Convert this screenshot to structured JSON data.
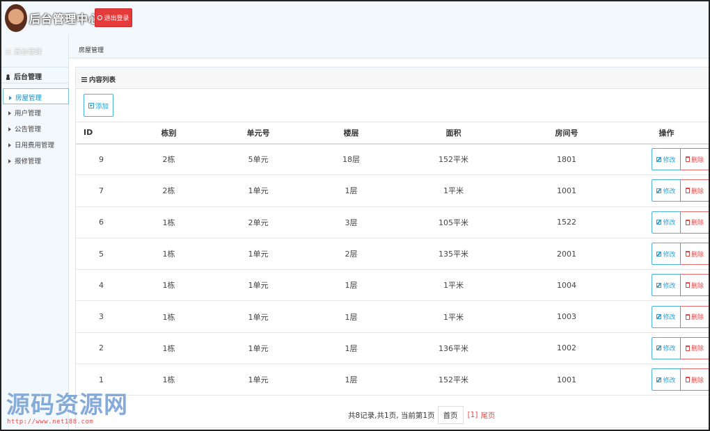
{
  "header": {
    "app_title": "后台管理中心",
    "logout_label": "退出登录"
  },
  "sidebar": {
    "top_label": "后台管理",
    "section_title": "后台管理",
    "items": [
      {
        "label": "房屋管理",
        "active": true
      },
      {
        "label": "用户管理",
        "active": false
      },
      {
        "label": "公告管理",
        "active": false
      },
      {
        "label": "日用费用管理",
        "active": false
      },
      {
        "label": "报修管理",
        "active": false
      }
    ]
  },
  "breadcrumb": "房屋管理",
  "panel": {
    "title": "内容列表",
    "add_label": "添加"
  },
  "table": {
    "headers": [
      "ID",
      "栋别",
      "单元号",
      "楼层",
      "面积",
      "房间号",
      "操作"
    ],
    "rows": [
      [
        "9",
        "2栋",
        "5单元",
        "18层",
        "152平米",
        "1801"
      ],
      [
        "7",
        "2栋",
        "1单元",
        "1层",
        "1平米",
        "1001"
      ],
      [
        "6",
        "1栋",
        "2单元",
        "3层",
        "105平米",
        "1522"
      ],
      [
        "5",
        "1栋",
        "1单元",
        "2层",
        "135平米",
        "2001"
      ],
      [
        "4",
        "1栋",
        "1单元",
        "1层",
        "1平米",
        "1004"
      ],
      [
        "3",
        "1栋",
        "1单元",
        "1层",
        "1平米",
        "1003"
      ],
      [
        "2",
        "1栋",
        "1单元",
        "1层",
        "136平米",
        "1002"
      ],
      [
        "1",
        "1栋",
        "1单元",
        "1层",
        "152平米",
        "1001"
      ]
    ],
    "edit_label": "修改",
    "delete_label": "删除"
  },
  "pager": {
    "summary": "共8记录,共1页, 当前第1页",
    "first_label": "首页",
    "page_label": "[1]",
    "last_label": "尾页"
  },
  "watermark": {
    "text": "源码资源网",
    "url": "http://www.net188.com"
  },
  "colors": {
    "primary": "#2f9ed0",
    "danger": "#e43a3a",
    "chrome_bg": "#f3f8fc"
  }
}
